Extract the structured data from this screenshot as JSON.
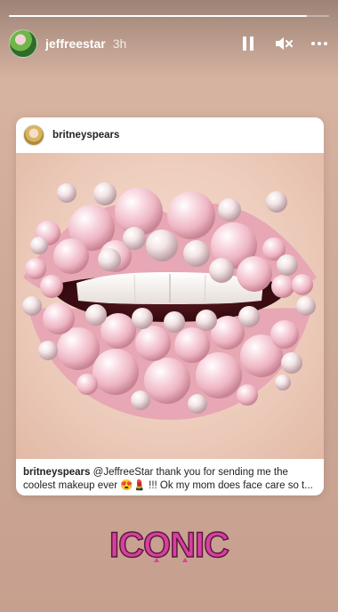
{
  "story": {
    "username": "jeffreestar",
    "time": "3h",
    "progress": 0.93,
    "controls": {
      "pause_icon": "pause-icon",
      "mute_icon": "speaker-muted-icon",
      "more_icon": "more-horizontal-icon"
    }
  },
  "post": {
    "username": "britneyspears",
    "caption_user": "britneyspears",
    "caption_text": "@JeffreeStar thank you for sending me the coolest makeup ever 😍💄 !!! Ok my mom does face care so t...",
    "image_icon": "lips-photo"
  },
  "sticker": {
    "text": "ICONIC",
    "color": "#d93fa0"
  }
}
